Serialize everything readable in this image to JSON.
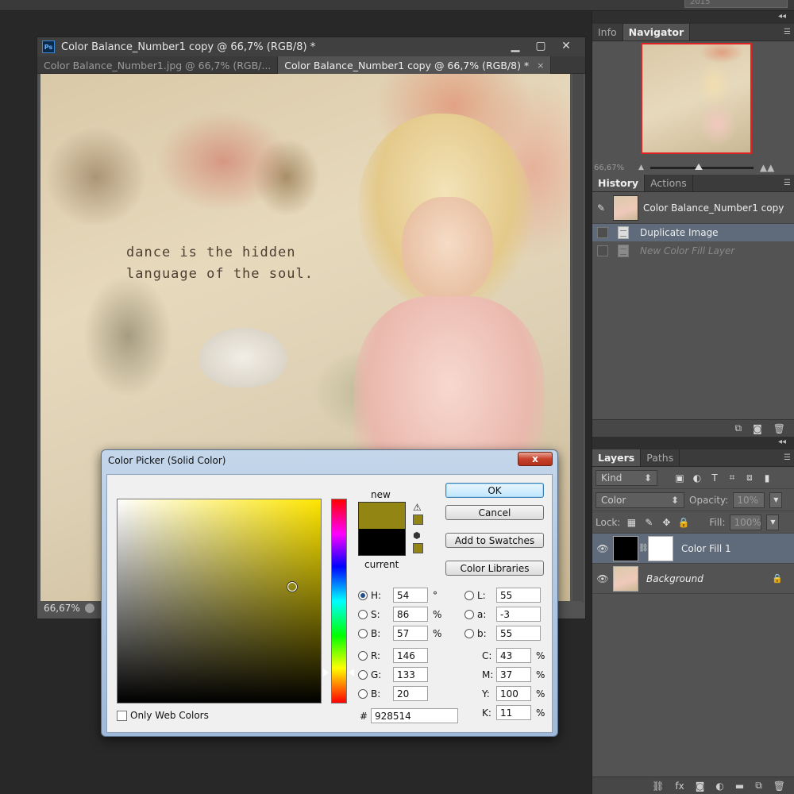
{
  "topbar": {
    "year": "2015"
  },
  "document": {
    "title": "Color Balance_Number1 copy @ 66,7% (RGB/8) *",
    "tabs": [
      {
        "label": "Color Balance_Number1.jpg @ 66,7% (RGB/..."
      },
      {
        "label": "Color Balance_Number1 copy @ 66,7% (RGB/8) *",
        "close": "×"
      }
    ],
    "zoom": "66,67%",
    "art_text_line1": "dance is the hidden",
    "art_text_line2": "language of the soul.",
    "ps_icon": "Ps"
  },
  "navigator": {
    "tabs": [
      "Info",
      "Navigator"
    ],
    "zoom": "66,67%"
  },
  "history": {
    "tabs": [
      "History",
      "Actions"
    ],
    "snapshot": "Color Balance_Number1 copy",
    "items": [
      {
        "label": "Duplicate Image",
        "selected": true
      },
      {
        "label": "New Color Fill Layer",
        "selected": false
      }
    ]
  },
  "layers": {
    "tabs": [
      "Layers",
      "Paths"
    ],
    "kind_label": "Kind",
    "blend_mode": "Color",
    "opacity_label": "Opacity:",
    "opacity_value": "10%",
    "lock_label": "Lock:",
    "fill_label": "Fill:",
    "fill_value": "100%",
    "items": [
      {
        "name": "Color Fill 1",
        "selected": true
      },
      {
        "name": "Background",
        "selected": false
      }
    ]
  },
  "color_picker": {
    "title": "Color Picker (Solid Color)",
    "close": "x",
    "new_label": "new",
    "current_label": "current",
    "new_color": "#928514",
    "current_color": "#000000",
    "gamut_color": "#928514",
    "buttons": {
      "ok": "OK",
      "cancel": "Cancel",
      "add_swatches": "Add to Swatches",
      "color_libraries": "Color Libraries"
    },
    "hsb": [
      {
        "label": "H:",
        "value": "54",
        "unit": "°",
        "selected": true
      },
      {
        "label": "S:",
        "value": "86",
        "unit": "%",
        "selected": false
      },
      {
        "label": "B:",
        "value": "57",
        "unit": "%",
        "selected": false
      }
    ],
    "rgb": [
      {
        "label": "R:",
        "value": "146"
      },
      {
        "label": "G:",
        "value": "133"
      },
      {
        "label": "B:",
        "value": "20"
      }
    ],
    "lab": [
      {
        "label": "L:",
        "value": "55"
      },
      {
        "label": "a:",
        "value": "-3"
      },
      {
        "label": "b:",
        "value": "55"
      }
    ],
    "cmyk": [
      {
        "label": "C:",
        "value": "43",
        "unit": "%"
      },
      {
        "label": "M:",
        "value": "37",
        "unit": "%"
      },
      {
        "label": "Y:",
        "value": "100",
        "unit": "%"
      },
      {
        "label": "K:",
        "value": "11",
        "unit": "%"
      }
    ],
    "hex_label": "#",
    "hex_value": "928514",
    "only_web_colors": "Only Web Colors"
  }
}
